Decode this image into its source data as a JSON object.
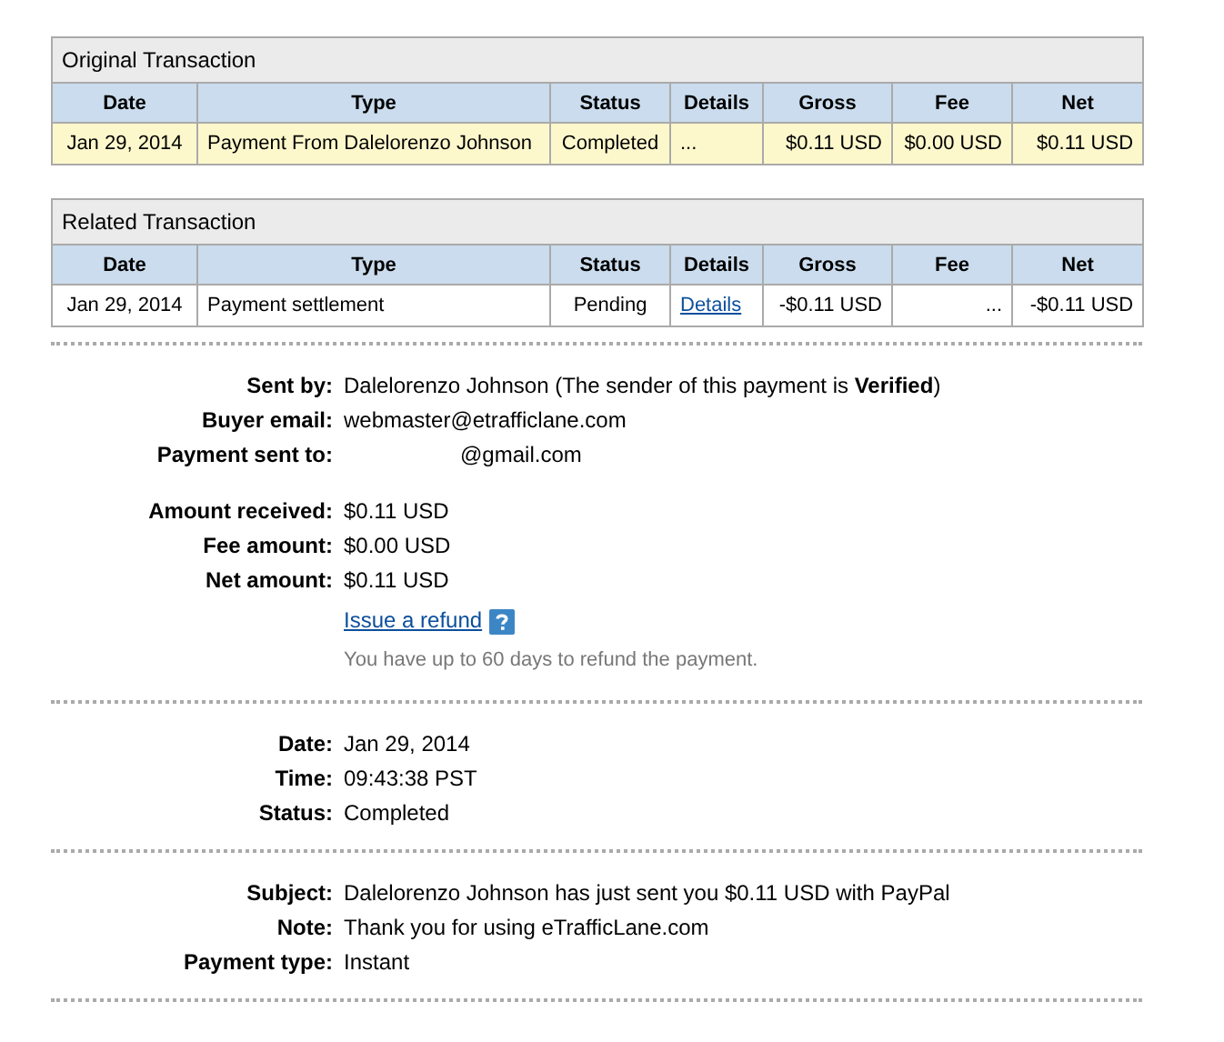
{
  "tables": [
    {
      "title": "Original Transaction",
      "columns": [
        "Date",
        "Type",
        "Status",
        "Details",
        "Gross",
        "Fee",
        "Net"
      ],
      "rows": [
        {
          "highlighted": true,
          "cells": [
            {
              "text": "Jan 29, 2014",
              "kind": "text"
            },
            {
              "text": "Payment From Dalelorenzo Johnson",
              "kind": "text"
            },
            {
              "text": "Completed",
              "kind": "text"
            },
            {
              "text": "...",
              "kind": "text"
            },
            {
              "text": "$0.11 USD",
              "kind": "text"
            },
            {
              "text": "$0.00 USD",
              "kind": "text"
            },
            {
              "text": "$0.11 USD",
              "kind": "text"
            }
          ]
        }
      ]
    },
    {
      "title": "Related Transaction",
      "columns": [
        "Date",
        "Type",
        "Status",
        "Details",
        "Gross",
        "Fee",
        "Net"
      ],
      "rows": [
        {
          "highlighted": false,
          "cells": [
            {
              "text": "Jan 29, 2014",
              "kind": "text"
            },
            {
              "text": "Payment settlement",
              "kind": "text"
            },
            {
              "text": "Pending",
              "kind": "text"
            },
            {
              "text": "Details",
              "kind": "link"
            },
            {
              "text": "-$0.11 USD",
              "kind": "text"
            },
            {
              "text": "...",
              "kind": "text"
            },
            {
              "text": "-$0.11 USD",
              "kind": "text"
            }
          ]
        }
      ]
    }
  ],
  "details": [
    [
      {
        "kind": "field",
        "label": "Sent by:",
        "value": "Dalelorenzo Johnson (The sender of this payment is **Verified**)"
      },
      {
        "kind": "field",
        "label": "Buyer email:",
        "value": "webmaster@etrafficlane.com"
      },
      {
        "kind": "field",
        "label": "Payment sent to:",
        "value": "@gmail.com",
        "redacted": true
      },
      {
        "kind": "spacer"
      },
      {
        "kind": "field",
        "label": "Amount received:",
        "value": "$0.11 USD"
      },
      {
        "kind": "field",
        "label": "Fee amount:",
        "value": "$0.00 USD"
      },
      {
        "kind": "field",
        "label": "Net amount:",
        "value": "$0.11 USD"
      },
      {
        "kind": "link",
        "text": "Issue a refund"
      },
      {
        "kind": "note",
        "text": "You have up to 60 days to refund the payment."
      }
    ],
    [
      {
        "kind": "field",
        "label": "Date:",
        "value": "Jan 29, 2014"
      },
      {
        "kind": "field",
        "label": "Time:",
        "value": "09:43:38 PST"
      },
      {
        "kind": "field",
        "label": "Status:",
        "value": "Completed"
      }
    ],
    [
      {
        "kind": "field",
        "label": "Subject:",
        "value": "Dalelorenzo Johnson has just sent you $0.11 USD with PayPal"
      },
      {
        "kind": "field",
        "label": "Note:",
        "value": "Thank you for using eTrafficLane.com"
      },
      {
        "kind": "field",
        "label": "Payment type:",
        "value": "Instant"
      }
    ]
  ]
}
